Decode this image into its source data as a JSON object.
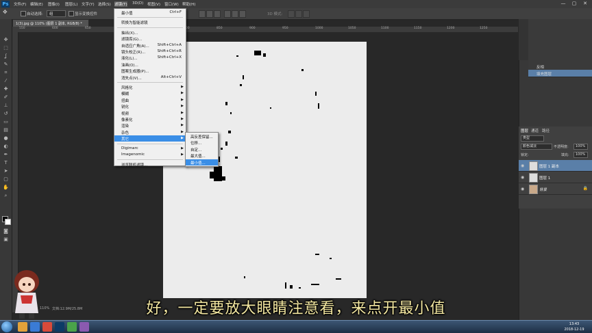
{
  "app": {
    "logo": "Ps"
  },
  "menubar": {
    "items": [
      "文件(F)",
      "编辑(E)",
      "图像(I)",
      "图层(L)",
      "文字(Y)",
      "选择(S)",
      "滤镜(T)",
      "3D(D)",
      "视图(V)",
      "窗口(W)",
      "帮助(H)"
    ],
    "active_index": 6,
    "window_controls": [
      "—",
      "▢",
      "✕"
    ]
  },
  "options": {
    "auto_select_label": "自动选择:",
    "auto_select_value": "组",
    "show_transform_label": "显示变换控件",
    "mode_3d_label": "3D 模式:"
  },
  "document": {
    "tab_title": "1(3).jpg @ 110% (图层 1 副本, RGB/8) *"
  },
  "ruler": {
    "labels": [
      "550",
      "600",
      "650",
      "700",
      "750",
      "800",
      "850",
      "900",
      "950",
      "1000",
      "1050",
      "1100",
      "1150",
      "1200",
      "1250"
    ]
  },
  "filter_menu": {
    "items": [
      {
        "label": "最小值",
        "shortcut": "Ctrl+F"
      },
      {
        "sep": true
      },
      {
        "label": "转换为智能滤镜"
      },
      {
        "sep": true
      },
      {
        "label": "抽出(X)..."
      },
      {
        "label": "滤镜库(G)..."
      },
      {
        "label": "自适应广角(A)...",
        "shortcut": "Shift+Ctrl+A"
      },
      {
        "label": "镜头校正(R)...",
        "shortcut": "Shift+Ctrl+R"
      },
      {
        "label": "液化(L)...",
        "shortcut": "Shift+Ctrl+X"
      },
      {
        "label": "油画(O)..."
      },
      {
        "label": "图案生成器(P)..."
      },
      {
        "label": "消失点(V)...",
        "shortcut": "Alt+Ctrl+V"
      },
      {
        "sep": true
      },
      {
        "label": "风格化",
        "submenu": true
      },
      {
        "label": "模糊",
        "submenu": true
      },
      {
        "label": "扭曲",
        "submenu": true
      },
      {
        "label": "锐化",
        "submenu": true
      },
      {
        "label": "视频",
        "submenu": true
      },
      {
        "label": "像素化",
        "submenu": true
      },
      {
        "label": "渲染",
        "submenu": true
      },
      {
        "label": "杂色",
        "submenu": true
      },
      {
        "label": "其它",
        "submenu": true,
        "highlight": true
      },
      {
        "sep": true
      },
      {
        "label": "Digimarc",
        "submenu": true
      },
      {
        "label": "Imagenomic",
        "submenu": true
      },
      {
        "sep": true
      },
      {
        "label": "浏览联机滤镜..."
      }
    ]
  },
  "other_submenu": {
    "items": [
      {
        "label": "高反差保留..."
      },
      {
        "label": "位移..."
      },
      {
        "label": "自定..."
      },
      {
        "label": "最大值..."
      },
      {
        "label": "最小值...",
        "highlight": true
      }
    ]
  },
  "history": {
    "items": [
      "反相",
      "填充图层"
    ],
    "selected_index": 1
  },
  "layers": {
    "tabs": [
      "图层",
      "通道",
      "路径"
    ],
    "kind_label": "类型",
    "blend_mode": "颜色减淡",
    "opacity_label": "不透明度:",
    "opacity_value": "100%",
    "lock_label": "锁定:",
    "fill_label": "填充:",
    "fill_value": "100%",
    "items": [
      {
        "name": "图层 1 副本",
        "selected": true,
        "lock": ""
      },
      {
        "name": "图层 1",
        "selected": false,
        "lock": ""
      },
      {
        "name": "背景",
        "selected": false,
        "lock": "🔒"
      }
    ]
  },
  "status": {
    "zoom": "110%",
    "doc_size": "文档:12.9M/25.8M"
  },
  "subtitle": "好，一定要放大眼睛注意看，来点开最小值",
  "clock": {
    "time": "13:43",
    "date": "2018-12-19"
  }
}
